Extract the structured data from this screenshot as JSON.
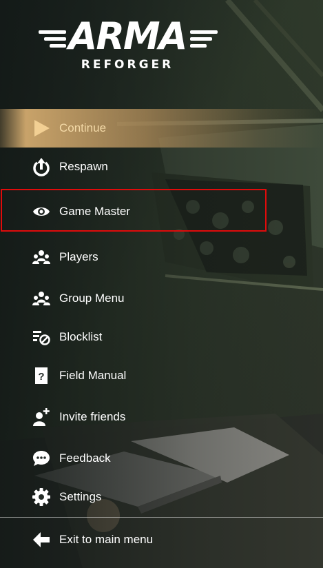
{
  "logo": {
    "title": "ARMA",
    "subtitle": "REFORGER"
  },
  "menu": {
    "items": [
      {
        "label": "Continue",
        "icon": "play-icon",
        "active": true
      },
      {
        "label": "Respawn",
        "icon": "respawn-icon"
      },
      {
        "label": "Game Master",
        "icon": "eye-icon",
        "highlighted": true
      },
      {
        "label": "Players",
        "icon": "players-icon"
      },
      {
        "label": "Group Menu",
        "icon": "group-icon"
      },
      {
        "label": "Blocklist",
        "icon": "blocklist-icon"
      },
      {
        "label": "Field Manual",
        "icon": "field-manual-icon"
      },
      {
        "label": "Invite friends",
        "icon": "invite-friends-icon"
      },
      {
        "label": "Feedback",
        "icon": "feedback-icon"
      },
      {
        "label": "Settings",
        "icon": "gear-icon"
      },
      {
        "label": "Exit to main menu",
        "icon": "arrow-left-icon"
      }
    ]
  },
  "colors": {
    "active_text": "#f3d9a7",
    "active_bg": "#c9a06a",
    "highlight_border": "#e10b0b",
    "text": "#ffffff"
  }
}
